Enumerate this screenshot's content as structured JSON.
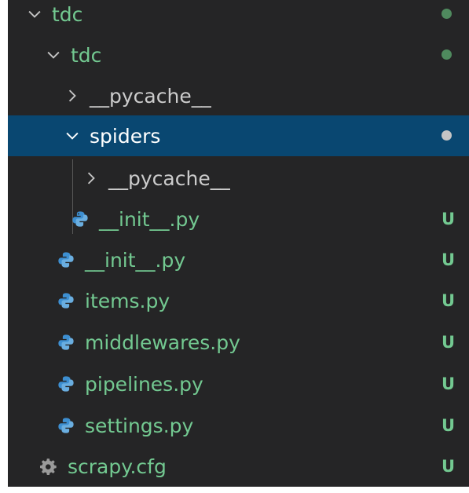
{
  "explorer": {
    "items": [
      {
        "label": "tdc",
        "icon": "chevron-down-icon",
        "decoration": "dot"
      },
      {
        "label": "tdc",
        "icon": "chevron-down-icon",
        "decoration": "dot"
      },
      {
        "label": "__pycache__",
        "icon": "chevron-right-icon"
      },
      {
        "label": "spiders",
        "icon": "chevron-down-icon",
        "decoration": "dot",
        "selected": true
      },
      {
        "label": "__pycache__",
        "icon": "chevron-right-icon"
      },
      {
        "label": "__init__.py",
        "icon": "python-icon",
        "status": "U"
      },
      {
        "label": "__init__.py",
        "icon": "python-icon",
        "status": "U"
      },
      {
        "label": "items.py",
        "icon": "python-icon",
        "status": "U"
      },
      {
        "label": "middlewares.py",
        "icon": "python-icon",
        "status": "U"
      },
      {
        "label": "pipelines.py",
        "icon": "python-icon",
        "status": "U"
      },
      {
        "label": "settings.py",
        "icon": "python-icon",
        "status": "U"
      },
      {
        "label": "scrapy.cfg",
        "icon": "gear-icon",
        "status": "U"
      }
    ]
  },
  "colors": {
    "background": "#252526",
    "selection": "#094771",
    "untracked": "#73c991",
    "muted": "#cccccc",
    "python_icon": "#3d8fd1"
  }
}
